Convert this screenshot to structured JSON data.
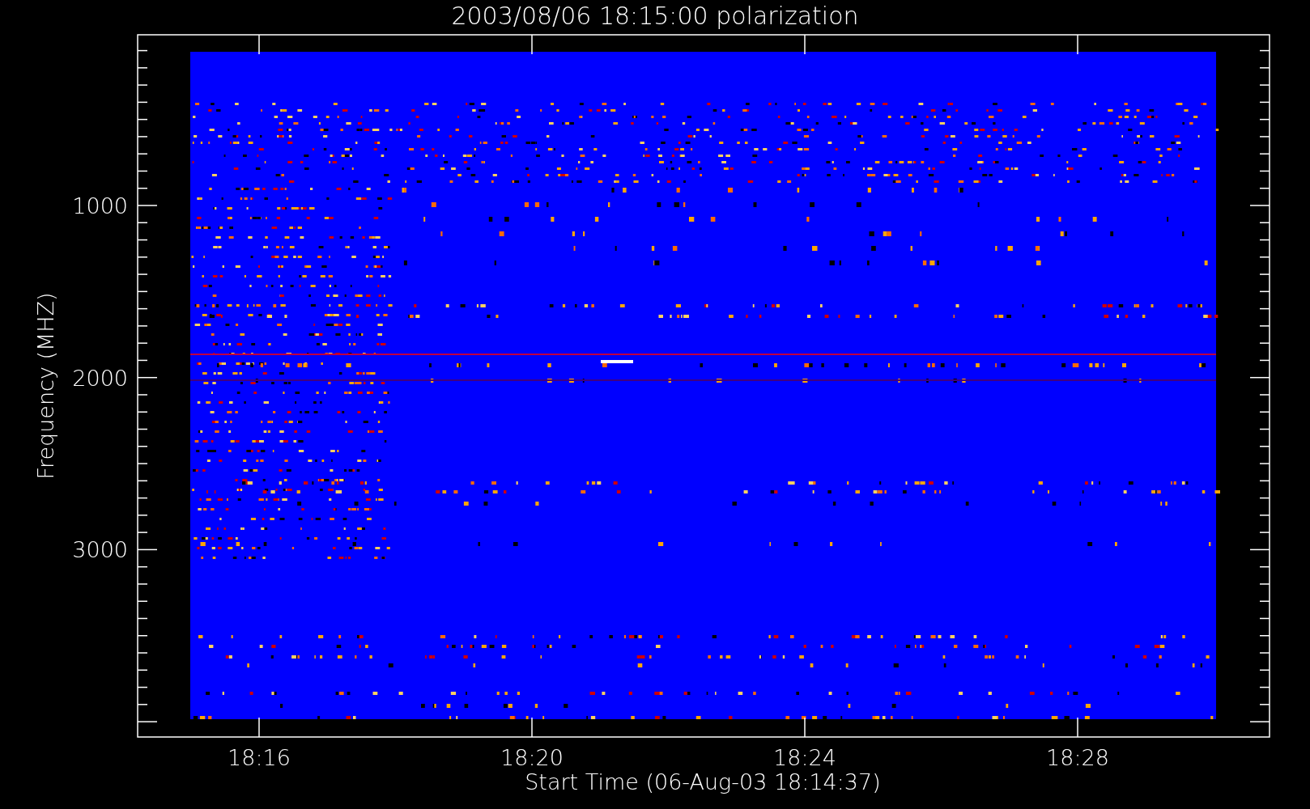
{
  "title": "2003/08/06 18:15:00 polarization",
  "y_axis": {
    "label": "Frequency (MHZ)",
    "ticks": [
      "1000",
      "2000",
      "3000"
    ]
  },
  "x_axis": {
    "label": "Start Time (06-Aug-03 18:14:37)",
    "ticks": [
      "18:16",
      "18:20",
      "18:24",
      "18:28"
    ]
  }
}
